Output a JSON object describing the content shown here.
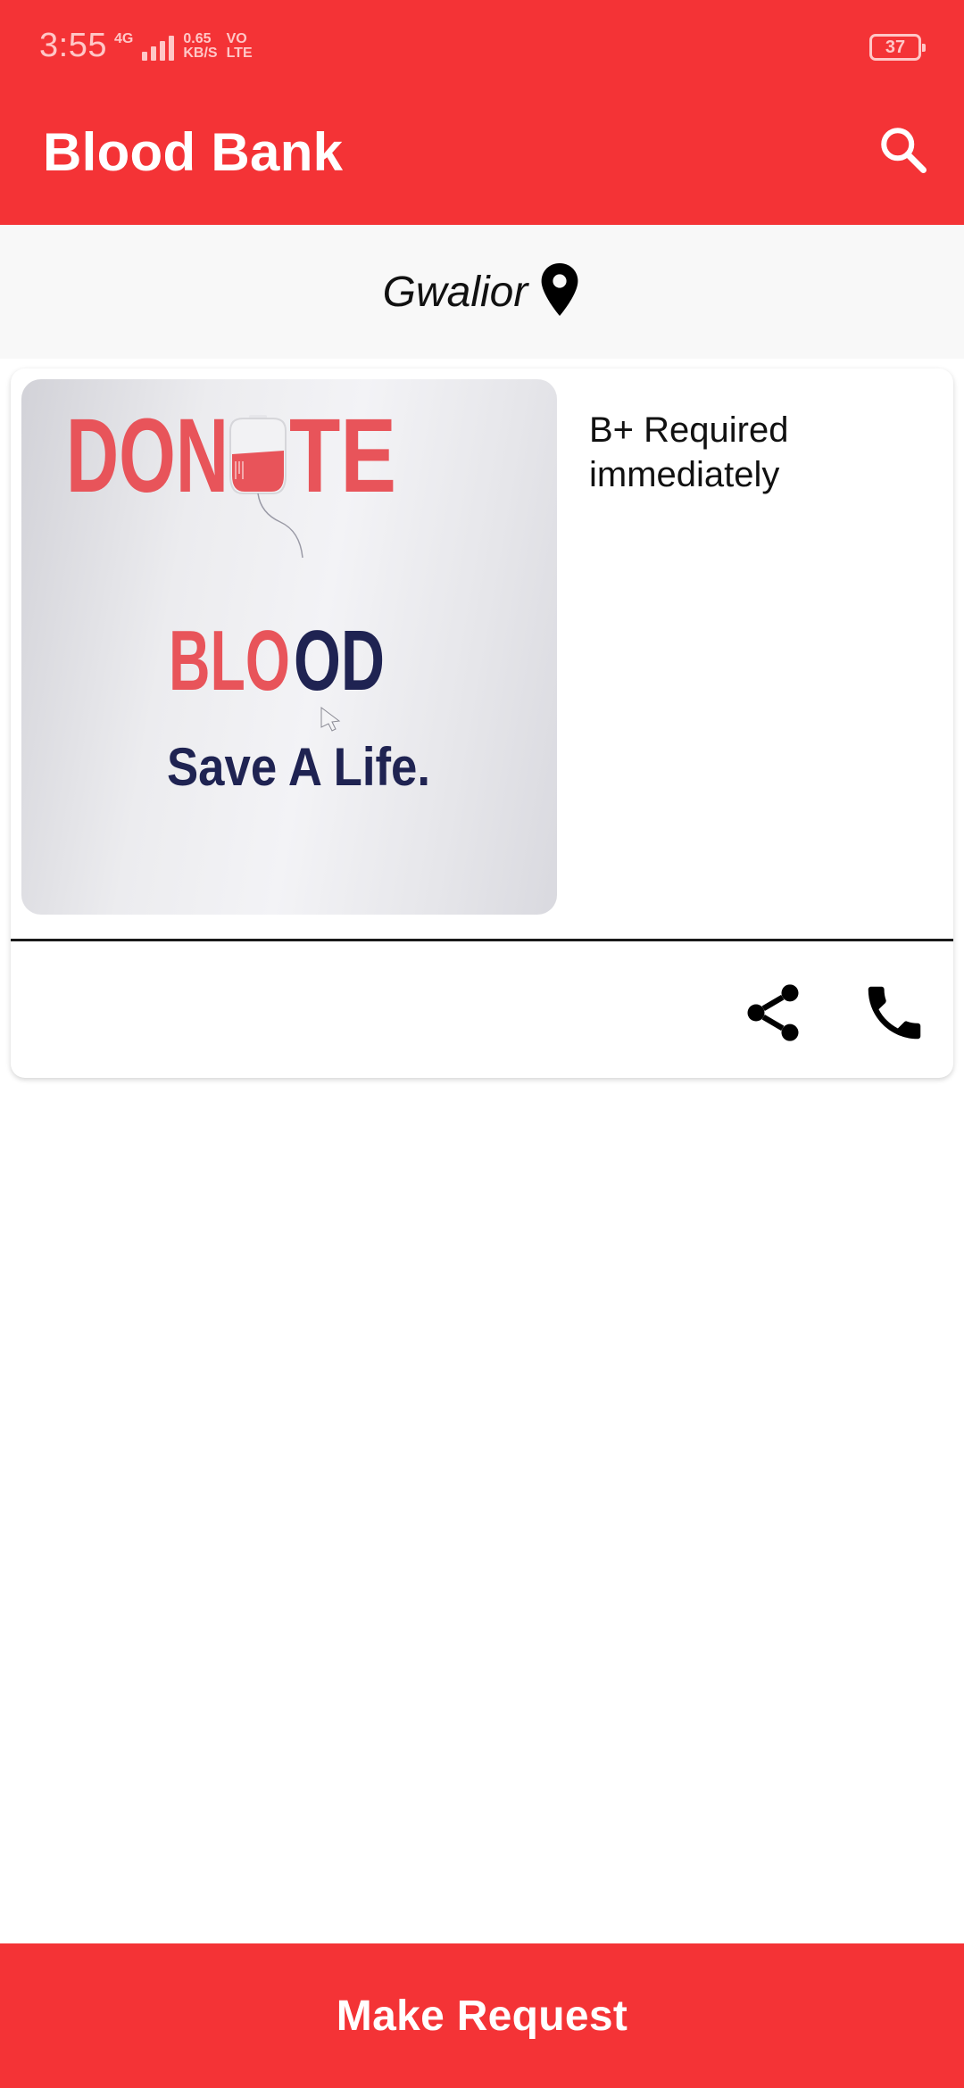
{
  "status_bar": {
    "time": "3:55",
    "network": "4G",
    "speed_value": "0.65",
    "speed_unit": "KB/S",
    "volte_top": "VO",
    "volte_bottom": "LTE",
    "battery": "37"
  },
  "toolbar": {
    "title": "Blood Bank",
    "search_icon": "search-icon"
  },
  "location": {
    "city": "Gwalior",
    "icon": "location-pin-icon"
  },
  "requests": [
    {
      "image": {
        "line1_left": "DON",
        "line1_right": "TE",
        "line2_left": "BLO",
        "line2_right": "OD",
        "line3": "Save A Life."
      },
      "message": "B+ Required immediately",
      "actions": [
        "share-icon",
        "phone-icon"
      ]
    }
  ],
  "footer": {
    "button_label": "Make Request"
  },
  "colors": {
    "primary": "#f43336",
    "location_bg": "#f8f8f8",
    "poster_red": "#e8545a",
    "poster_navy": "#1f2352"
  }
}
